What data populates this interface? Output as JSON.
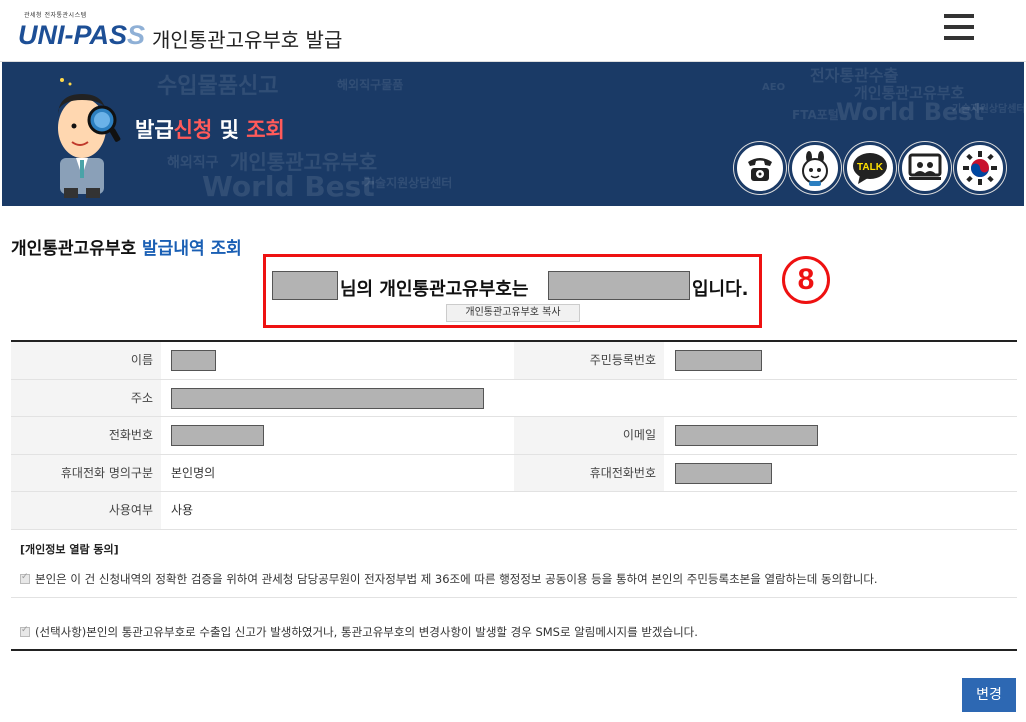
{
  "header": {
    "logo_sub": "관세청 전자통관시스템",
    "logo_uni": "UNI",
    "logo_dash": "-",
    "logo_pass": "PAS",
    "logo_tail": "S",
    "title": "개인통관고유부호 발급"
  },
  "banner": {
    "title_part1": "발급",
    "title_part2": "신청",
    "title_part3": " 및 ",
    "title_part4": "조회",
    "icons": [
      "phone-icon",
      "mascot-chat-icon",
      "talk-icon",
      "remote-support-icon",
      "government-emblem-icon"
    ],
    "talk_label": "TALK",
    "bg_words": [
      "수입물품신고",
      "해외직구물품",
      "전자통관수출",
      "개인통관고유부호",
      "World Best",
      "FTA포털",
      "기술지원상담센터",
      "해외직구",
      "AEO"
    ]
  },
  "section": {
    "title_part1": "개인통관고유부호 ",
    "title_part2": "발급내역 조회"
  },
  "result": {
    "text_middle": "님의 개인통관고유부호는",
    "text_end": "입니다.",
    "copy_button": "개인통관고유부호 복사",
    "step_badge": "8"
  },
  "info": {
    "name_label": "이름",
    "rrn_label": "주민등록번호",
    "address_label": "주소",
    "phone_label": "전화번호",
    "email_label": "이메일",
    "mobile_owner_label": "휴대전화 명의구분",
    "mobile_owner_value": "본인명의",
    "mobile_label": "휴대전화번호",
    "usage_label": "사용여부",
    "usage_value": "사용"
  },
  "consent": {
    "title": "[개인정보 열람 동의]",
    "item1": "본인은 이 건 신청내역의 정확한 검증을 위하여 관세청 담당공무원이 전자정부법 제 36조에 따른 행정정보 공동이용 등을 통하여 본인의 주민등록초본을 열람하는데 동의합니다.",
    "item2": "(선택사항)본인의 통관고유부호로 수출입 신고가 발생하였거나, 통관고유부호의 변경사항이 발생할 경우 SMS로 알림메시지를 받겠습니다."
  },
  "actions": {
    "change_button": "변경"
  },
  "colors": {
    "accent_blue": "#1a5fb4",
    "banner_bg": "#1a3a66",
    "highlight_red": "#e11111",
    "button_blue": "#2d68b3"
  }
}
